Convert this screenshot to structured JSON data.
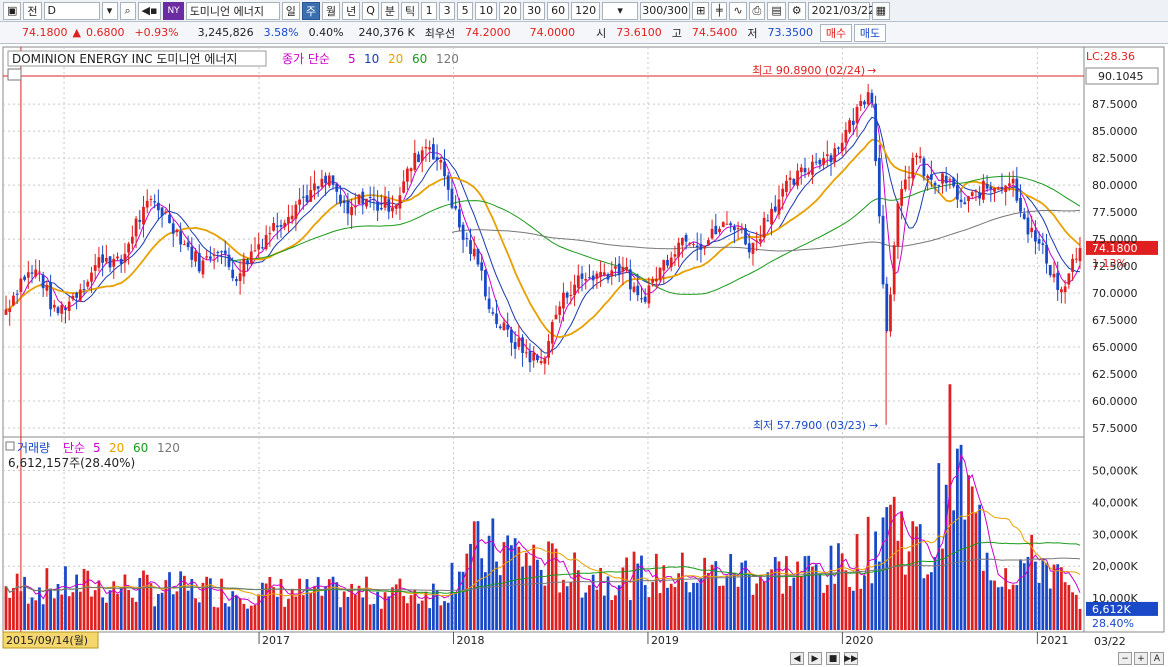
{
  "toolbar": {
    "market": "전",
    "code": "D",
    "ny_badge": "NY",
    "stock_name": "도미니언 에너지",
    "periods": [
      "일",
      "주",
      "월",
      "년",
      "Q",
      "분",
      "틱",
      "1",
      "3",
      "5",
      "10",
      "20",
      "30",
      "60",
      "120"
    ],
    "selected_period": "주",
    "count": "300/300",
    "date": "2021/03/22"
  },
  "quote": {
    "price": "74.1800",
    "change": "0.6800",
    "change_pct": "+0.93%",
    "volume": "3,245,826",
    "vol_pct": "3.58%",
    "turnover_pct": "0.40%",
    "amount": "240,376 K",
    "bid_label": "최우선",
    "bid": "74.2000",
    "ask": "74.0000",
    "open_label": "시",
    "open": "73.6100",
    "high_label": "고",
    "high": "74.5400",
    "low_label": "저",
    "low": "73.3500",
    "buy_label": "매수",
    "sell_label": "매도"
  },
  "colors": {
    "up": "#e02020",
    "down": "#1a49c8",
    "ma5": "#cc00cc",
    "ma10": "#1a3ab0",
    "ma20": "#e8a000",
    "ma60": "#1a9a1a",
    "ma120": "#777777"
  },
  "chart_data": [
    {
      "type": "candlestick",
      "title": "DOMINION ENERGY INC  도미니언 에너지",
      "legend": [
        {
          "label": "종가 단순",
          "color": "#cc00cc"
        },
        {
          "label": "5",
          "color": "#cc00cc"
        },
        {
          "label": "10",
          "color": "#1a3ab0"
        },
        {
          "label": "20",
          "color": "#e8a000"
        },
        {
          "label": "60",
          "color": "#1a9a1a"
        },
        {
          "label": "120",
          "color": "#777777"
        }
      ],
      "x_ticks": [
        "2016",
        "2017",
        "2018",
        "2019",
        "2020",
        "2021"
      ],
      "x_range_label": "2015/09/14(월)",
      "x_end_label": "03/22",
      "y_ticks": [
        "87.5000",
        "85.0000",
        "82.5000",
        "80.0000",
        "77.5000",
        "75.0000",
        "72.5000",
        "70.0000",
        "67.5000",
        "65.0000",
        "62.5000",
        "60.0000",
        "57.5000"
      ],
      "ylim": [
        57.5,
        90.1045
      ],
      "lc_label": "LC:28.36",
      "high_price_tag": "90.1045",
      "current_tag": "74.1800",
      "current_pct_tag": "1.13%",
      "max_annotation": "최고 90.8900 (02/24)",
      "min_annotation": "최저 57.7900 (03/23)",
      "close_path": [
        [
          "2015-09-14",
          68.5
        ],
        [
          "2015-10-15",
          71.5
        ],
        [
          "2015-11-15",
          72.0
        ],
        [
          "2015-12-15",
          68.0
        ],
        [
          "2016-01-15",
          69.5
        ],
        [
          "2016-02-15",
          71.5
        ],
        [
          "2016-03-15",
          73.5
        ],
        [
          "2016-04-15",
          72.5
        ],
        [
          "2016-05-15",
          76.5
        ],
        [
          "2016-06-15",
          78.5
        ],
        [
          "2016-07-15",
          77.0
        ],
        [
          "2016-08-15",
          74.5
        ],
        [
          "2016-09-15",
          72.5
        ],
        [
          "2016-10-15",
          74.5
        ],
        [
          "2016-11-15",
          71.5
        ],
        [
          "2016-12-15",
          73.5
        ],
        [
          "2017-01-15",
          75.5
        ],
        [
          "2017-02-15",
          77.0
        ],
        [
          "2017-03-15",
          78.5
        ],
        [
          "2017-04-15",
          79.5
        ],
        [
          "2017-05-15",
          80.5
        ],
        [
          "2017-06-15",
          77.0
        ],
        [
          "2017-07-15",
          79.0
        ],
        [
          "2017-08-15",
          78.0
        ],
        [
          "2017-09-15",
          78.5
        ],
        [
          "2017-10-15",
          82.0
        ],
        [
          "2017-11-15",
          84.0
        ],
        [
          "2017-12-15",
          81.0
        ],
        [
          "2018-01-15",
          75.5
        ],
        [
          "2018-02-15",
          73.0
        ],
        [
          "2018-03-15",
          68.0
        ],
        [
          "2018-04-15",
          66.0
        ],
        [
          "2018-05-15",
          64.5
        ],
        [
          "2018-06-15",
          63.5
        ],
        [
          "2018-07-15",
          68.5
        ],
        [
          "2018-08-15",
          71.0
        ],
        [
          "2018-09-15",
          71.5
        ],
        [
          "2018-10-15",
          72.0
        ],
        [
          "2018-11-15",
          72.5
        ],
        [
          "2018-12-15",
          69.0
        ],
        [
          "2019-01-15",
          71.5
        ],
        [
          "2019-02-15",
          74.0
        ],
        [
          "2019-03-15",
          75.5
        ],
        [
          "2019-04-15",
          74.5
        ],
        [
          "2019-05-15",
          76.0
        ],
        [
          "2019-06-15",
          76.5
        ],
        [
          "2019-07-15",
          74.0
        ],
        [
          "2019-08-15",
          77.5
        ],
        [
          "2019-09-15",
          79.5
        ],
        [
          "2019-10-15",
          81.0
        ],
        [
          "2019-11-15",
          82.5
        ],
        [
          "2019-12-15",
          83.0
        ],
        [
          "2020-01-15",
          85.5
        ],
        [
          "2020-02-24",
          89.5
        ],
        [
          "2020-03-23",
          66.5
        ],
        [
          "2020-04-15",
          78.0
        ],
        [
          "2020-05-15",
          83.0
        ],
        [
          "2020-06-15",
          80.0
        ],
        [
          "2020-07-15",
          80.5
        ],
        [
          "2020-08-15",
          78.0
        ],
        [
          "2020-09-15",
          79.5
        ],
        [
          "2020-10-15",
          80.0
        ],
        [
          "2020-11-15",
          80.5
        ],
        [
          "2020-12-15",
          76.0
        ],
        [
          "2021-01-15",
          73.5
        ],
        [
          "2021-02-15",
          70.0
        ],
        [
          "2021-03-22",
          74.18
        ]
      ]
    },
    {
      "type": "bar",
      "title": "거래량",
      "legend": [
        {
          "label": "거래량",
          "color": "#1a49c8"
        },
        {
          "label": "단순",
          "color": "#cc00cc"
        },
        {
          "label": "5",
          "color": "#cc00cc"
        },
        {
          "label": "20",
          "color": "#e8a000"
        },
        {
          "label": "60",
          "color": "#1a9a1a"
        },
        {
          "label": "120",
          "color": "#777777"
        }
      ],
      "info": "6,612,157주(28.40%)",
      "y_ticks": [
        "50,000K",
        "40,000K",
        "30,000K",
        "20,000K",
        "10,000K"
      ],
      "ylim": [
        0,
        58000
      ],
      "last_tag": "6,612K",
      "last_pct_tag": "28.40%",
      "volume_path_k": [
        [
          "2015-09-14",
          13000
        ],
        [
          "2016-01-15",
          14000
        ],
        [
          "2016-06-15",
          13000
        ],
        [
          "2017-01-15",
          12000
        ],
        [
          "2017-06-15",
          11500
        ],
        [
          "2017-12-15",
          12000
        ],
        [
          "2018-01-15",
          24000
        ],
        [
          "2018-04-15",
          25000
        ],
        [
          "2018-08-15",
          17000
        ],
        [
          "2019-01-15",
          17000
        ],
        [
          "2019-06-15",
          18000
        ],
        [
          "2019-12-15",
          18500
        ],
        [
          "2020-02-24",
          25000
        ],
        [
          "2020-03-23",
          39000
        ],
        [
          "2020-06-15",
          20000
        ],
        [
          "2020-07-15",
          56000
        ],
        [
          "2020-10-15",
          19000
        ],
        [
          "2021-01-15",
          22000
        ],
        [
          "2021-03-22",
          6612
        ]
      ]
    }
  ],
  "statusbar": {
    "nav_buttons": [
      "◀",
      "▶",
      "■",
      "▶▶"
    ],
    "zoom_buttons": [
      "−",
      "+",
      "A"
    ]
  }
}
